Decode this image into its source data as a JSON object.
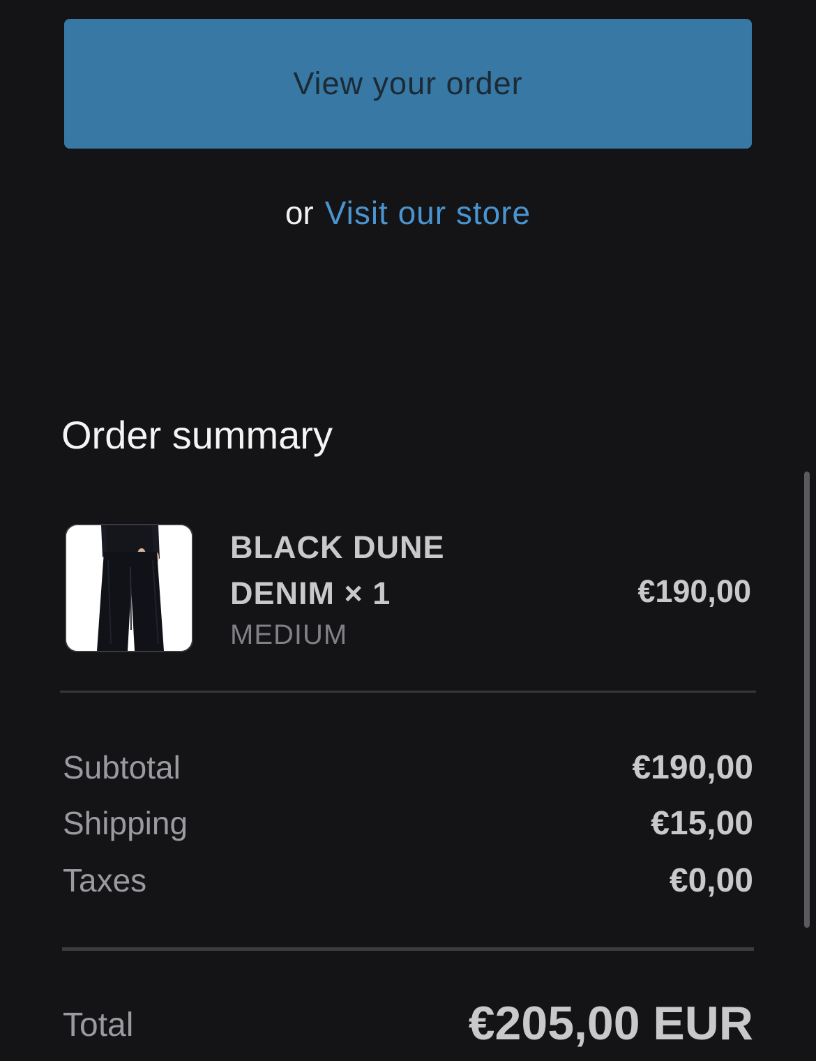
{
  "actions": {
    "view_order_label": "View your order",
    "or_text": "or",
    "visit_store_label": "Visit our store"
  },
  "summary": {
    "title": "Order summary",
    "item": {
      "name": "BLACK DUNE DENIM × 1",
      "variant": "MEDIUM",
      "price": "€190,00",
      "image_icon": "product-photo-black-wide-leg-jeans"
    },
    "subtotal_label": "Subtotal",
    "subtotal_value": "€190,00",
    "shipping_label": "Shipping",
    "shipping_value": "€15,00",
    "taxes_label": "Taxes",
    "taxes_value": "€0,00",
    "total_label": "Total",
    "total_value": "€205,00 EUR"
  },
  "colors": {
    "background": "#141416",
    "button": "#3878a4",
    "link": "#4a94cf"
  }
}
